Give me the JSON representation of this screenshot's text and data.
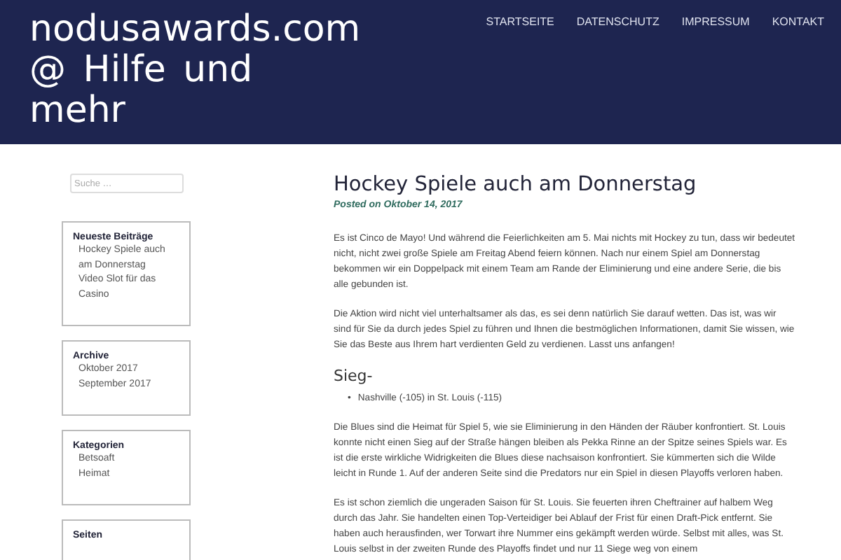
{
  "site_title": "nodusawards.com @ Hilfe und mehr",
  "nav": [
    {
      "label": "STARTSEITE"
    },
    {
      "label": "DATENSCHUTZ"
    },
    {
      "label": "IMPRESSUM"
    },
    {
      "label": "KONTAKT"
    }
  ],
  "search": {
    "placeholder": "Suche …"
  },
  "widgets": [
    {
      "title": "Neueste Beiträge",
      "items": [
        "Hockey Spiele auch am Donnerstag",
        "Video Slot für das Casino"
      ]
    },
    {
      "title": "Archive",
      "items": [
        "Oktober 2017",
        "September 2017"
      ]
    },
    {
      "title": "Kategorien",
      "items": [
        "Betsoaft",
        "Heimat"
      ]
    },
    {
      "title": "Seiten"
    }
  ],
  "post": {
    "title": "Hockey Spiele auch am Donnerstag",
    "meta": "Posted on Oktober 14, 2017",
    "blocks": [
      {
        "kind": "p",
        "text": "Es ist Cinco de Mayo! Und während die Feierlichkeiten am 5. Mai nichts mit Hockey zu tun, dass wir bedeutet nicht, nicht zwei große Spiele am Freitag Abend feiern können. Nach nur einem Spiel am Donnerstag bekommen wir ein Doppelpack mit einem Team am Rande der Eliminierung und eine andere Serie, die bis alle gebunden ist."
      },
      {
        "kind": "p",
        "text": "Die Aktion wird nicht viel unterhaltsamer als das, es sei denn natürlich Sie darauf wetten. Das ist, was wir sind für Sie da durch jedes Spiel zu führen und Ihnen die bestmöglichen Informationen, damit Sie wissen, wie Sie das Beste aus Ihrem hart verdienten Geld zu verdienen. Lasst uns anfangen!"
      },
      {
        "kind": "h",
        "text": "Sieg-"
      },
      {
        "kind": "li",
        "marker": "•",
        "text": "Nashville (-105) in St. Louis (-115)"
      },
      {
        "kind": "p",
        "text": "Die Blues sind die Heimat für Spiel 5, wie sie Eliminierung in den Händen der Räuber konfrontiert. St. Louis konnte nicht einen Sieg auf der Straße hängen bleiben als Pekka Rinne an der Spitze seines Spiels war. Es ist die erste wirkliche Widrigkeiten die Blues diese nachsaison konfrontiert. Sie kümmerten sich die Wilde leicht in Runde 1. Auf der anderen Seite sind die Predators nur ein Spiel in diesen Playoffs verloren haben."
      },
      {
        "kind": "p",
        "text": "Es ist schon ziemlich die ungeraden Saison für St. Louis. Sie feuerten ihren Cheftrainer auf halbem Weg durch das Jahr. Sie handelten einen Top-Verteidiger bei Ablauf der Frist für einen Draft-Pick entfernt. Sie haben auch herausfinden, wer Torwart ihre Nummer eins gekämpft werden würde. Selbst mit alles, was St. Louis selbst in der zweiten Runde des Playoffs findet und nur 11 Siege weg von einem"
      }
    ]
  }
}
